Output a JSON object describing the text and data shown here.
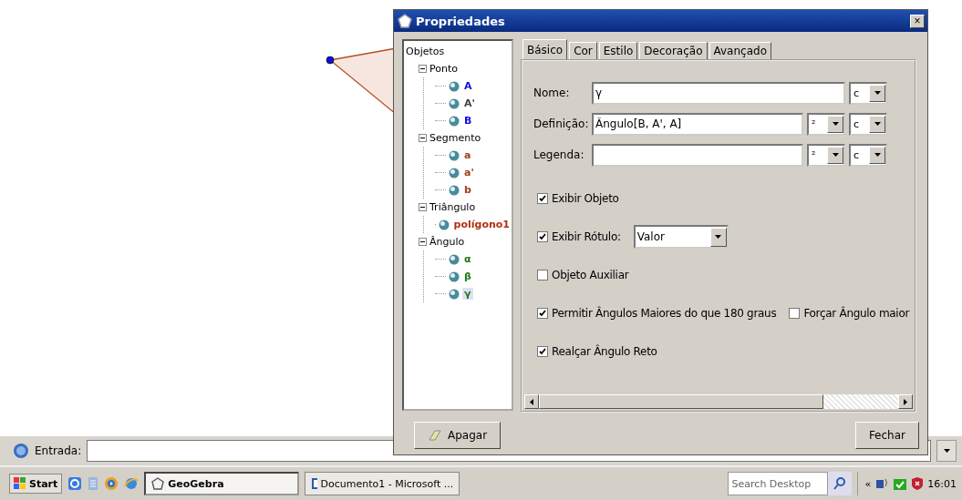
{
  "dialog": {
    "title": "Propriedades",
    "close": "×",
    "tree": {
      "label": "Objetos",
      "children": [
        {
          "label": "Ponto",
          "expanded": true,
          "children": [
            {
              "label": "A",
              "color": "#1010e0",
              "selected": false
            },
            {
              "label": "A'",
              "color": "#404040",
              "selected": false
            },
            {
              "label": "B",
              "color": "#1010e0",
              "selected": false
            }
          ]
        },
        {
          "label": "Segmento",
          "expanded": true,
          "children": [
            {
              "label": "a",
              "color": "#a0401a",
              "selected": false
            },
            {
              "label": "a'",
              "color": "#a0401a",
              "selected": false
            },
            {
              "label": "b",
              "color": "#a0401a",
              "selected": false
            }
          ]
        },
        {
          "label": "Triângulo",
          "expanded": true,
          "children": [
            {
              "label": "polígono1",
              "color": "#b03010",
              "selected": false
            }
          ]
        },
        {
          "label": "Ângulo",
          "expanded": true,
          "children": [
            {
              "label": "α",
              "color": "#1a7a1a",
              "selected": false
            },
            {
              "label": "β",
              "color": "#1a7a1a",
              "selected": false
            },
            {
              "label": "γ",
              "color": "#1a7a1a",
              "selected": true
            }
          ]
        }
      ]
    },
    "tabs": [
      {
        "label": "Básico",
        "selected": true
      },
      {
        "label": "Cor",
        "selected": false
      },
      {
        "label": "Estilo",
        "selected": false
      },
      {
        "label": "Decoração",
        "selected": false
      },
      {
        "label": "Avançado",
        "selected": false
      }
    ],
    "fields": [
      {
        "label": "Nome:",
        "value": "γ",
        "combos": [
          "c"
        ]
      },
      {
        "label": "Definição:",
        "value": "Ângulo[B, A', A]",
        "combos": [
          "²",
          "c"
        ]
      },
      {
        "label": "Legenda:",
        "combos": [
          "²",
          "c"
        ]
      }
    ],
    "options": [
      {
        "items": [
          {
            "kind": "checkbox",
            "label": "Exibir Objeto",
            "checked": true
          }
        ]
      },
      {
        "items": [
          {
            "kind": "checkbox",
            "label": "Exibir Rótulo:",
            "checked": true
          },
          {
            "kind": "dropdown",
            "value": "Valor"
          }
        ]
      },
      {
        "items": [
          {
            "kind": "checkbox",
            "label": "Objeto Auxiliar",
            "checked": false
          }
        ]
      },
      {
        "items": [
          {
            "kind": "checkbox",
            "label": "Permitir Ângulos Maiores do que 180 graus",
            "checked": true
          },
          {
            "kind": "checkbox",
            "label": "Forçar Ângulo maior",
            "checked": false
          }
        ]
      },
      {
        "items": [
          {
            "kind": "checkbox",
            "label": "Realçar Ângulo Reto",
            "checked": true
          }
        ]
      }
    ],
    "buttons": [
      {
        "label": "Apagar",
        "kind": "erase"
      },
      {
        "label": "Fechar",
        "kind": "plain"
      }
    ]
  },
  "input_bar": {
    "label": "Entrada:"
  },
  "taskbar": {
    "start": "Start",
    "tasks": [
      {
        "label": "GeoGebra",
        "selected": true,
        "kind": "geogebra"
      },
      {
        "label": "Documento1 - Microsoft ...",
        "selected": false,
        "kind": "word"
      }
    ],
    "search": {
      "placeholder": "Search Desktop"
    },
    "tray_toggle": "«",
    "clock": "16:01"
  }
}
